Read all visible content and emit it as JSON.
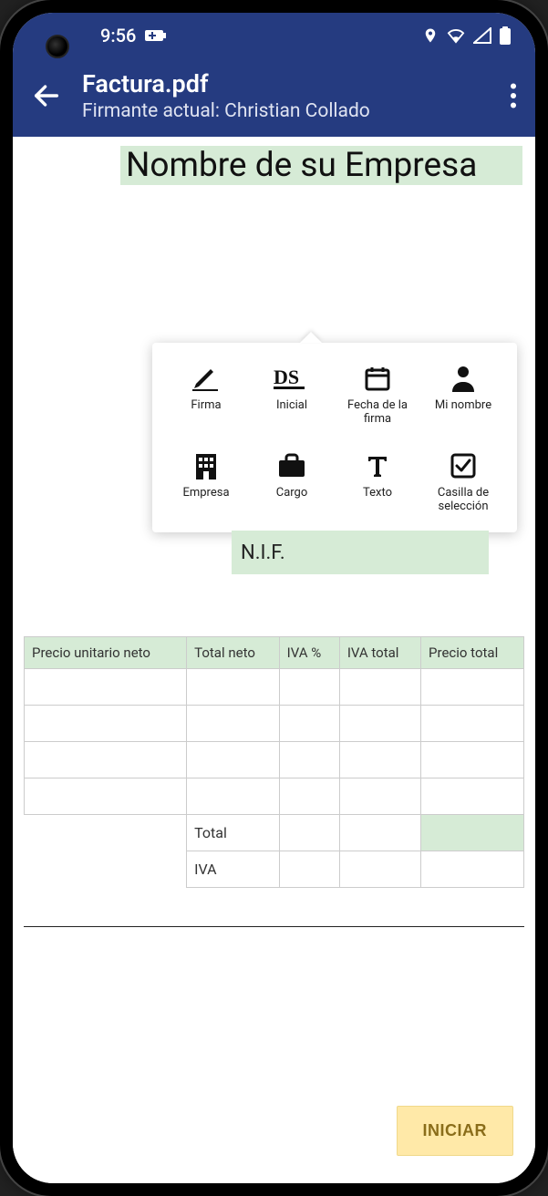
{
  "status": {
    "time": "9:56"
  },
  "appbar": {
    "title": "Factura.pdf",
    "subtitle": "Firmante actual: Christian Collado"
  },
  "document": {
    "company_placeholder": "Nombre de su Empresa",
    "nif_label": "N.I.F."
  },
  "popover": {
    "items": [
      {
        "key": "signature",
        "label": "Firma"
      },
      {
        "key": "initial",
        "label": "Inicial"
      },
      {
        "key": "date",
        "label": "Fecha de la firma"
      },
      {
        "key": "myname",
        "label": "Mi nombre"
      },
      {
        "key": "company",
        "label": "Empresa"
      },
      {
        "key": "title",
        "label": "Cargo"
      },
      {
        "key": "text",
        "label": "Texto"
      },
      {
        "key": "checkbox",
        "label": "Casilla de selección"
      }
    ]
  },
  "table": {
    "headers": [
      "Precio unitario neto",
      "Total neto",
      "IVA %",
      "IVA total",
      "Precio total"
    ],
    "summary": {
      "total_label": "Total",
      "iva_label": "IVA"
    }
  },
  "actions": {
    "start": "INICIAR"
  }
}
